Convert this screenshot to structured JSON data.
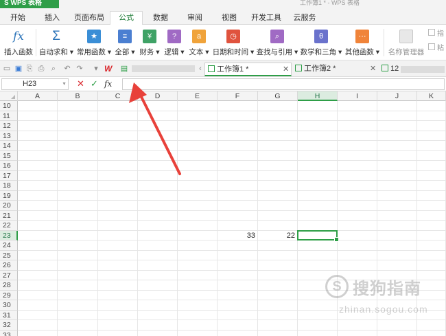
{
  "app": {
    "menu_label": "S WPS 表格",
    "doc_title": "工作簿1 * - WPS 表格"
  },
  "ribbon_tabs": [
    {
      "label": "开始"
    },
    {
      "label": "插入"
    },
    {
      "label": "页面布局"
    },
    {
      "label": "公式",
      "active": true
    },
    {
      "label": "数据"
    },
    {
      "label": "审阅"
    },
    {
      "label": "视图"
    },
    {
      "label": "开发工具"
    },
    {
      "label": "云服务"
    }
  ],
  "ribbon": {
    "insert_function": "插入函数",
    "autosum": "自动求和",
    "common": "常用函数",
    "all": "全部",
    "finance": "财务",
    "logic": "逻辑",
    "text": "文本",
    "datetime": "日期和时间",
    "lookup": "查找与引用",
    "math": "数学和三角",
    "other": "其他函数",
    "name_manager": "名称管理器",
    "paste": "粘",
    "point": "指"
  },
  "doc_tabs": {
    "tab1": "工作簿1 *",
    "tab2": "工作簿2 *",
    "tab3": "12"
  },
  "formula_bar": {
    "cell_ref": "H23",
    "cancel_icon": "✕",
    "confirm_icon": "✓",
    "fx_icon": "fx",
    "value": ""
  },
  "columns": [
    "A",
    "B",
    "C",
    "D",
    "E",
    "F",
    "G",
    "H",
    "I",
    "J",
    "K"
  ],
  "rows": [
    "10",
    "11",
    "12",
    "13",
    "14",
    "15",
    "16",
    "17",
    "18",
    "19",
    "20",
    "21",
    "22",
    "23",
    "24",
    "25",
    "26",
    "27",
    "28",
    "29",
    "30",
    "31",
    "32",
    "33"
  ],
  "cells": {
    "F23": "33",
    "G23": "22"
  },
  "selected": {
    "column": "H",
    "row": "23"
  },
  "watermark": {
    "circle": "S",
    "text": "搜狗指南",
    "sub": "zhinan.sogou.com"
  },
  "colors": {
    "accent": "#2e9e47",
    "arrow": "#e8413a"
  }
}
